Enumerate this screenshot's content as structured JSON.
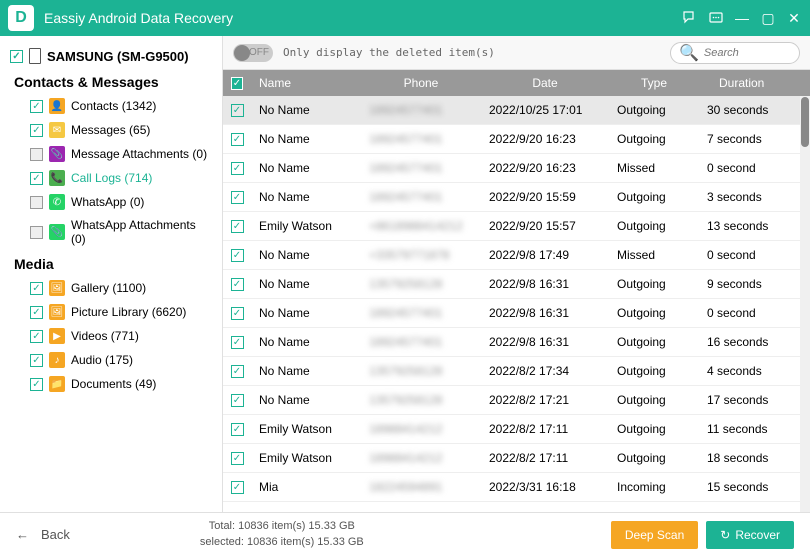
{
  "app_title": "Eassiy Android Data Recovery",
  "device_name": "SAMSUNG (SM-G9500)",
  "sections": {
    "contacts_messages": "Contacts & Messages",
    "media": "Media"
  },
  "sidebar": {
    "contacts": {
      "label": "Contacts (1342)",
      "color": "#f5a623"
    },
    "messages": {
      "label": "Messages (65)",
      "color": "#f5c842"
    },
    "msg_attach": {
      "label": "Message Attachments (0)",
      "color": "#888"
    },
    "call_logs": {
      "label": "Call Logs (714)",
      "color": "#4caf50"
    },
    "whatsapp": {
      "label": "WhatsApp (0)",
      "color": "#888"
    },
    "wa_attach": {
      "label": "WhatsApp Attachments (0)",
      "color": "#25d366"
    },
    "gallery": {
      "label": "Gallery (1100)",
      "color": "#f5a623"
    },
    "pic_lib": {
      "label": "Picture Library (6620)",
      "color": "#f5a623"
    },
    "videos": {
      "label": "Videos (771)",
      "color": "#f5a623"
    },
    "audio": {
      "label": "Audio (175)",
      "color": "#f5a623"
    },
    "documents": {
      "label": "Documents (49)",
      "color": "#f5a623"
    }
  },
  "toolbar": {
    "toggle_state": "OFF",
    "filter_text": "Only display the deleted item(s)",
    "search_placeholder": "Search"
  },
  "table": {
    "headers": {
      "name": "Name",
      "phone": "Phone",
      "date": "Date",
      "type": "Type",
      "duration": "Duration"
    },
    "rows": [
      {
        "name": "No Name",
        "phone": "18924577401",
        "date": "2022/10/25 17:01",
        "type": "Outgoing",
        "duration": "30 seconds",
        "selected": true
      },
      {
        "name": "No Name",
        "phone": "18924577401",
        "date": "2022/9/20 16:23",
        "type": "Outgoing",
        "duration": "7 seconds"
      },
      {
        "name": "No Name",
        "phone": "18924577401",
        "date": "2022/9/20 16:23",
        "type": "Missed",
        "duration": "0 second"
      },
      {
        "name": "No Name",
        "phone": "18924577401",
        "date": "2022/9/20 15:59",
        "type": "Outgoing",
        "duration": "3 seconds"
      },
      {
        "name": "Emily Watson",
        "phone": "+8618988414212",
        "date": "2022/9/20 15:57",
        "type": "Outgoing",
        "duration": "13 seconds"
      },
      {
        "name": "No Name",
        "phone": "+33579771878",
        "date": "2022/9/8 17:49",
        "type": "Missed",
        "duration": "0 second"
      },
      {
        "name": "No Name",
        "phone": "13579258128",
        "date": "2022/9/8 16:31",
        "type": "Outgoing",
        "duration": "9 seconds"
      },
      {
        "name": "No Name",
        "phone": "18924577401",
        "date": "2022/9/8 16:31",
        "type": "Outgoing",
        "duration": "0 second"
      },
      {
        "name": "No Name",
        "phone": "18924577401",
        "date": "2022/9/8 16:31",
        "type": "Outgoing",
        "duration": "16 seconds"
      },
      {
        "name": "No Name",
        "phone": "13579258128",
        "date": "2022/8/2 17:34",
        "type": "Outgoing",
        "duration": "4 seconds"
      },
      {
        "name": "No Name",
        "phone": "13579258128",
        "date": "2022/8/2 17:21",
        "type": "Outgoing",
        "duration": "17 seconds"
      },
      {
        "name": "Emily Watson",
        "phone": "18988414212",
        "date": "2022/8/2 17:11",
        "type": "Outgoing",
        "duration": "11 seconds"
      },
      {
        "name": "Emily Watson",
        "phone": "18988414212",
        "date": "2022/8/2 17:11",
        "type": "Outgoing",
        "duration": "18 seconds"
      },
      {
        "name": "Mia",
        "phone": "18224594891",
        "date": "2022/3/31 16:18",
        "type": "Incoming",
        "duration": "15 seconds"
      }
    ]
  },
  "footer": {
    "back": "Back",
    "total": "Total: 10836 item(s) 15.33 GB",
    "selected": "selected: 10836 item(s) 15.33 GB",
    "deep_scan": "Deep Scan",
    "recover": "Recover"
  }
}
